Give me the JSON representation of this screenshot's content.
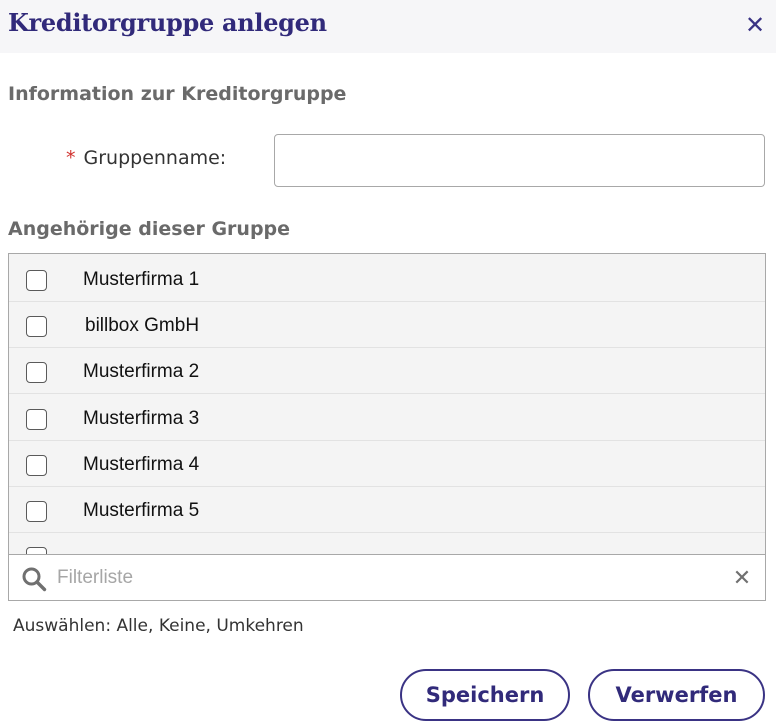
{
  "dialog": {
    "title": "Kreditorgruppe anlegen",
    "close_icon": "close-icon"
  },
  "info_section": {
    "title": "Information zur Kreditorgruppe",
    "required_marker": "*",
    "group_name_label": "Gruppenname:",
    "group_name_value": ""
  },
  "members_section": {
    "title": "Angehörige dieser Gruppe",
    "items": [
      {
        "label": "Musterfirma 1",
        "checked": false
      },
      {
        "label": "billbox GmbH",
        "checked": false
      },
      {
        "label": "Musterfirma 2",
        "checked": false
      },
      {
        "label": "Musterfirma 3",
        "checked": false
      },
      {
        "label": "Musterfirma 4",
        "checked": false
      },
      {
        "label": "Musterfirma 5",
        "checked": false
      }
    ],
    "filter_placeholder": "Filterliste",
    "select_prefix": "Auswählen:",
    "select_all": "Alle",
    "select_none": "Keine",
    "select_invert": "Umkehren"
  },
  "buttons": {
    "save": "Speichern",
    "discard": "Verwerfen"
  },
  "colors": {
    "accent": "#312a7a",
    "header_bg": "#f6f6f8",
    "required": "#d0312d"
  }
}
